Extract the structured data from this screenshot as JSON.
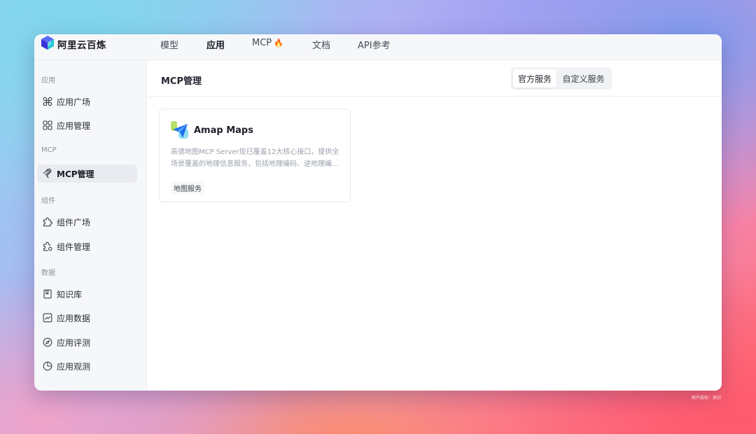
{
  "app": {
    "brand_name": "阿里云百炼"
  },
  "nav": {
    "items": [
      {
        "label": "模型"
      },
      {
        "label": "应用"
      },
      {
        "label": "MCP",
        "emoji": "🔥"
      },
      {
        "label": "文档"
      },
      {
        "label": "API参考"
      }
    ],
    "active": "应用"
  },
  "sidebar": {
    "sections": [
      {
        "label": "应用"
      },
      {
        "label": "MCP"
      },
      {
        "label": "组件"
      },
      {
        "label": "数据"
      }
    ],
    "items": [
      {
        "label": "应用广场",
        "icon": "grid-cmd-icon"
      },
      {
        "label": "应用管理",
        "icon": "grid-squares-icon"
      },
      {
        "label": "MCP管理",
        "icon": "mcp-icon"
      },
      {
        "label": "组件广场",
        "icon": "puzzle-icon"
      },
      {
        "label": "组件管理",
        "icon": "puzzle-gear-icon"
      },
      {
        "label": "知识库",
        "icon": "book-icon"
      },
      {
        "label": "应用数据",
        "icon": "line-chart-icon"
      },
      {
        "label": "应用评测",
        "icon": "compass-icon"
      },
      {
        "label": "应用观测",
        "icon": "pie-chart-icon"
      }
    ],
    "active": "MCP管理"
  },
  "main": {
    "title": "MCP管理",
    "segments": [
      {
        "label": "官方服务"
      },
      {
        "label": "自定义服务"
      }
    ],
    "active_segment": "官方服务",
    "cards": [
      {
        "title": "Amap Maps",
        "description": "高德地图MCP Server现已覆盖12大核心接口，提供全场景覆盖的地理信息服务，包括地理编码、逆地理编...",
        "tag": "地图服务",
        "icon": "amap-logo-icon"
      }
    ]
  },
  "watermark": "图片版权：原创",
  "colors": {
    "accent_text": "#1b1d26",
    "muted_text": "#9aa0ab",
    "active_bg": "#e9ebf0",
    "fire": "#f07a2d"
  }
}
